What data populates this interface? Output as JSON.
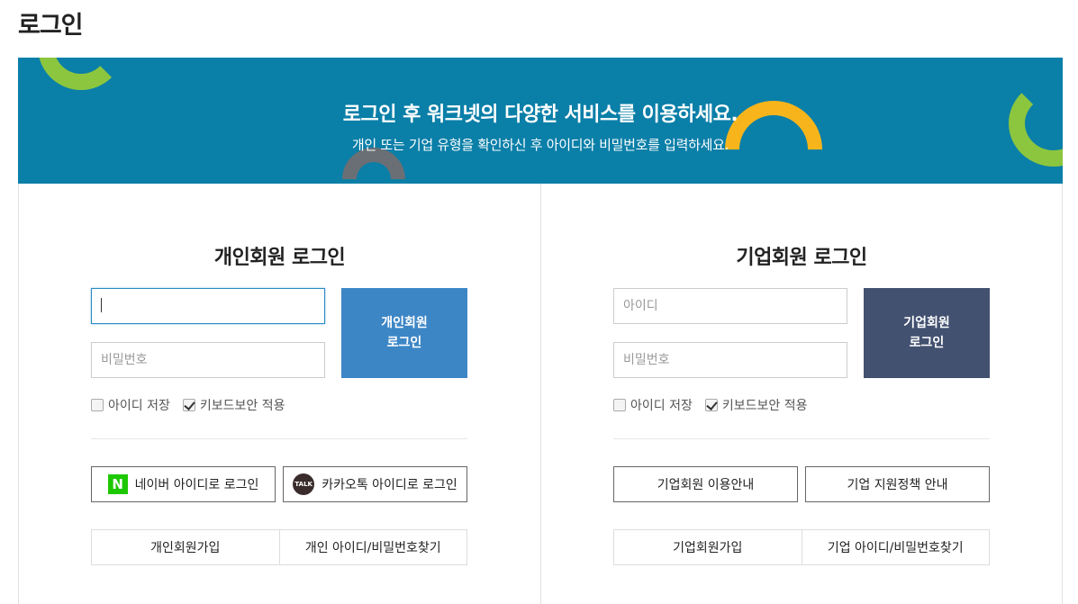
{
  "page": {
    "title": "로그인"
  },
  "banner": {
    "title": "로그인 후 워크넷의 다양한 서비스를 이용하세요.",
    "subtitle": "개인 또는 기업 유형을 확인하신 후 아이디와 비밀번호를 입력하세요.",
    "colors": {
      "background": "#0a7fa8",
      "green": "#8cc63f",
      "yellow": "#f7b51b"
    }
  },
  "personal": {
    "title": "개인회원 로그인",
    "id_value": "",
    "password_placeholder": "비밀번호",
    "login_line1": "개인회원",
    "login_line2": "로그인",
    "save_id_label": "아이디 저장",
    "keyboard_security_label": "키보드보안 적용",
    "naver_logo": "N",
    "naver_label": "네이버 아이디로 로그인",
    "kakao_logo": "TALK",
    "kakao_label": "카카오톡 아이디로 로그인",
    "signup_label": "개인회원가입",
    "find_label": "개인 아이디/비밀번호찾기"
  },
  "corporate": {
    "title": "기업회원 로그인",
    "id_placeholder": "아이디",
    "password_placeholder": "비밀번호",
    "login_line1": "기업회원",
    "login_line2": "로그인",
    "save_id_label": "아이디 저장",
    "keyboard_security_label": "키보드보안 적용",
    "guide_label": "기업회원 이용안내",
    "policy_label": "기업 지원정책 안내",
    "signup_label": "기업회원가입",
    "find_label": "기업 아이디/비밀번호찾기"
  }
}
